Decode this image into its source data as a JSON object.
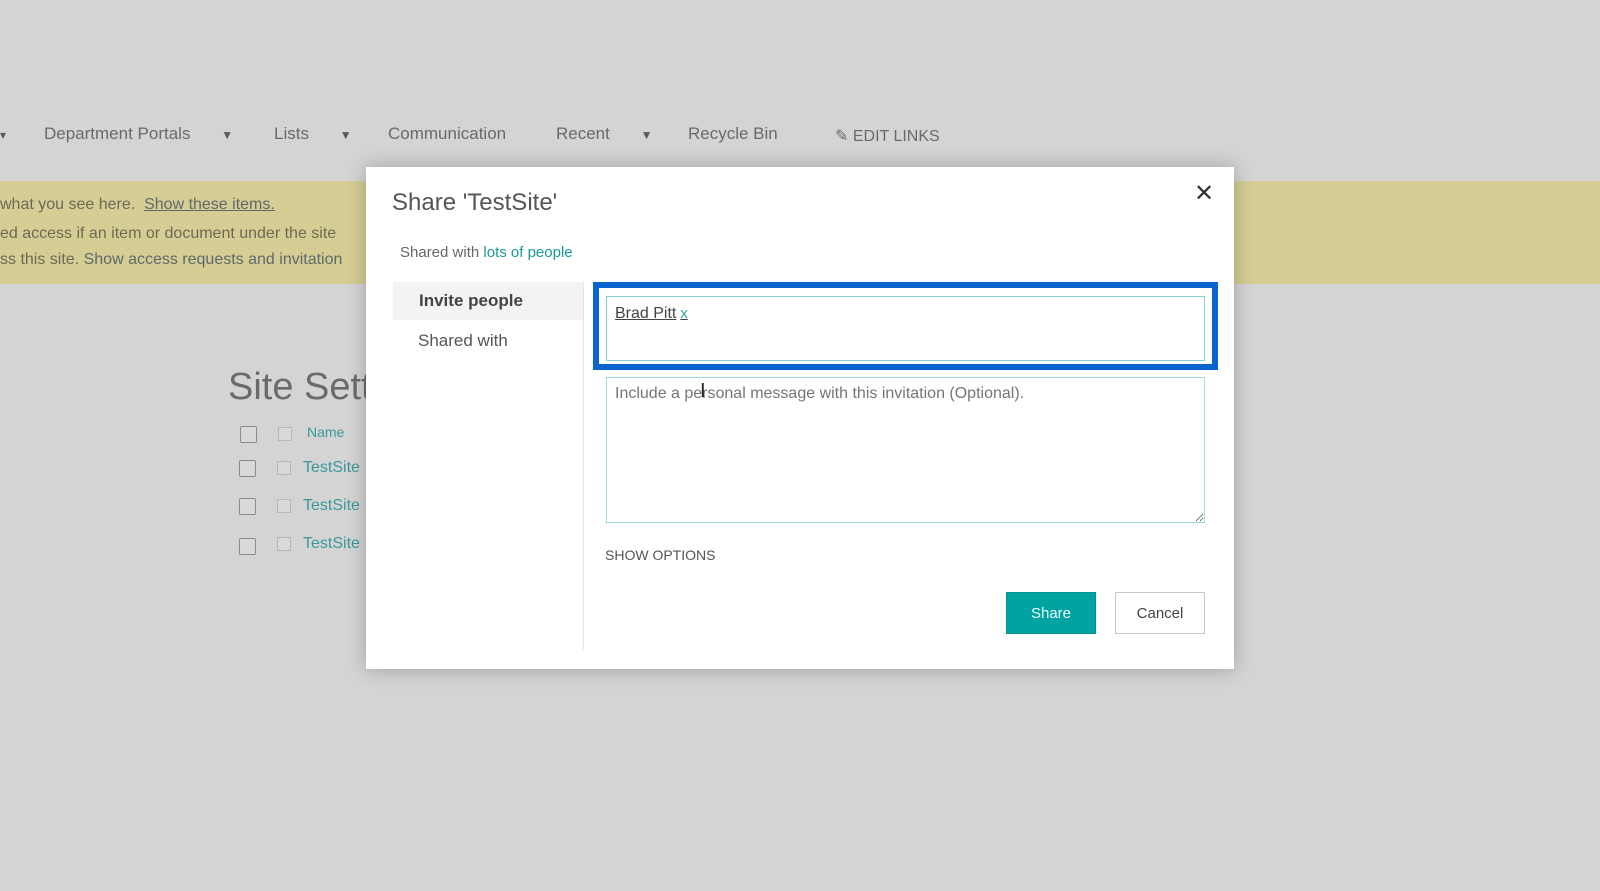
{
  "nav": {
    "items": [
      {
        "label": "Department Portals",
        "has_dropdown": true
      },
      {
        "label": "Lists",
        "has_dropdown": true
      },
      {
        "label": "Communication",
        "has_dropdown": false
      },
      {
        "label": "Recent",
        "has_dropdown": true
      },
      {
        "label": "Recycle Bin",
        "has_dropdown": false
      }
    ],
    "edit_links": "EDIT LINKS",
    "caret": "▼"
  },
  "banner": {
    "line1_prefix": "what you see here.",
    "line1_link": "Show these items.",
    "line2": "ed access if an item or document under the site",
    "line3_prefix": "ss this site.",
    "line3_link": "Show access requests and invitation",
    "color": "#d6cd95"
  },
  "page": {
    "heading": "Site Sett",
    "list_header": "Name",
    "rows": [
      "TestSite",
      "TestSite",
      "TestSite"
    ]
  },
  "dialog": {
    "title": "Share 'TestSite'",
    "close": "✕",
    "shared_with_prefix": "Shared with",
    "shared_with_link": "lots of people",
    "tabs": [
      "Invite people",
      "Shared with"
    ],
    "person": "Brad Pitt",
    "remove": "x",
    "message_placeholder": "Include a personal message with this invitation (Optional).",
    "show_options": "SHOW OPTIONS",
    "share_label": "Share",
    "cancel_label": "Cancel",
    "accent": "#01a3a1",
    "focus_color": "#0a64d0"
  }
}
